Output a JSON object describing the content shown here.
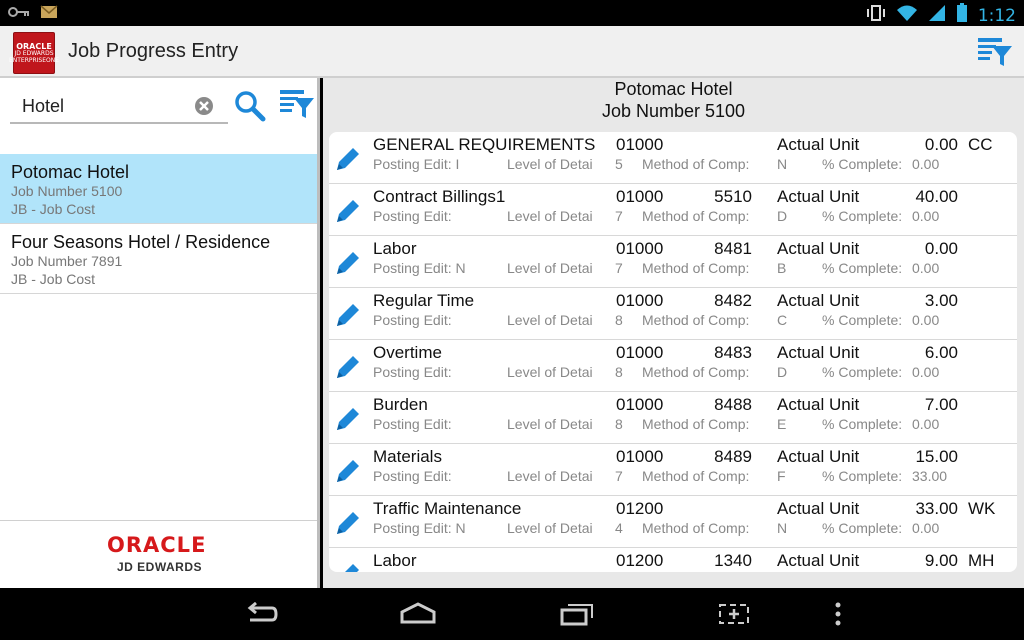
{
  "status_bar": {
    "time": "1:12",
    "icons": [
      "key-icon",
      "mail-icon",
      "vibrate-icon",
      "wifi-icon",
      "signal-icon",
      "battery-icon"
    ]
  },
  "action_bar": {
    "title": "Job Progress Entry",
    "logo_text": [
      "ORACLE",
      "JD EDWARDS",
      "ENTERPRISEONE"
    ]
  },
  "search": {
    "value": "Hotel",
    "placeholder": ""
  },
  "jobs": [
    {
      "title": "Potomac Hotel",
      "number": "Job Number 5100",
      "type": "JB - Job Cost",
      "selected": true
    },
    {
      "title": "Four Seasons Hotel / Residence",
      "number": "Job Number 7891",
      "type": "JB - Job Cost",
      "selected": false
    }
  ],
  "footer": {
    "brand": "ORACLE",
    "sub": "JD EDWARDS"
  },
  "detail": {
    "title": "Potomac Hotel",
    "subtitle": "Job Number 5100",
    "labels": {
      "posting_edit": "Posting Edit:",
      "level_of_detail": "Level of Detai",
      "method_of_comp": "Method of Comp:",
      "actual_unit": "Actual Unit",
      "percent_complete": "% Complete:"
    },
    "rows": [
      {
        "name": "GENERAL REQUIREMENTS",
        "posting_edit": "I",
        "level": "5",
        "code1": "01000",
        "code2": "",
        "method": "N",
        "actual": "0.00",
        "percent": "0.00",
        "unit": "CC"
      },
      {
        "name": "Contract Billings1",
        "posting_edit": "",
        "level": "7",
        "code1": "01000",
        "code2": "5510",
        "method": "D",
        "actual": "40.00",
        "percent": "0.00",
        "unit": ""
      },
      {
        "name": "Labor",
        "posting_edit": "N",
        "level": "7",
        "code1": "01000",
        "code2": "8481",
        "method": "B",
        "actual": "0.00",
        "percent": "0.00",
        "unit": ""
      },
      {
        "name": "Regular Time",
        "posting_edit": "",
        "level": "8",
        "code1": "01000",
        "code2": "8482",
        "method": "C",
        "actual": "3.00",
        "percent": "0.00",
        "unit": ""
      },
      {
        "name": "Overtime",
        "posting_edit": "",
        "level": "8",
        "code1": "01000",
        "code2": "8483",
        "method": "D",
        "actual": "6.00",
        "percent": "0.00",
        "unit": ""
      },
      {
        "name": "Burden",
        "posting_edit": "",
        "level": "8",
        "code1": "01000",
        "code2": "8488",
        "method": "E",
        "actual": "7.00",
        "percent": "0.00",
        "unit": ""
      },
      {
        "name": "Materials",
        "posting_edit": "",
        "level": "7",
        "code1": "01000",
        "code2": "8489",
        "method": "F",
        "actual": "15.00",
        "percent": "33.00",
        "unit": ""
      },
      {
        "name": "Traffic Maintenance",
        "posting_edit": "N",
        "level": "4",
        "code1": "01200",
        "code2": "",
        "method": "N",
        "actual": "33.00",
        "percent": "0.00",
        "unit": "WK"
      },
      {
        "name": "Labor",
        "posting_edit": "",
        "level": "",
        "code1": "01200",
        "code2": "1340",
        "method": "",
        "actual": "9.00",
        "percent": "",
        "unit": "MH"
      }
    ]
  },
  "colors": {
    "accent": "#1e88d8",
    "selected_row": "#b1e4fa",
    "oracle_red": "#d6191b",
    "status_blue": "#33b5e5"
  }
}
